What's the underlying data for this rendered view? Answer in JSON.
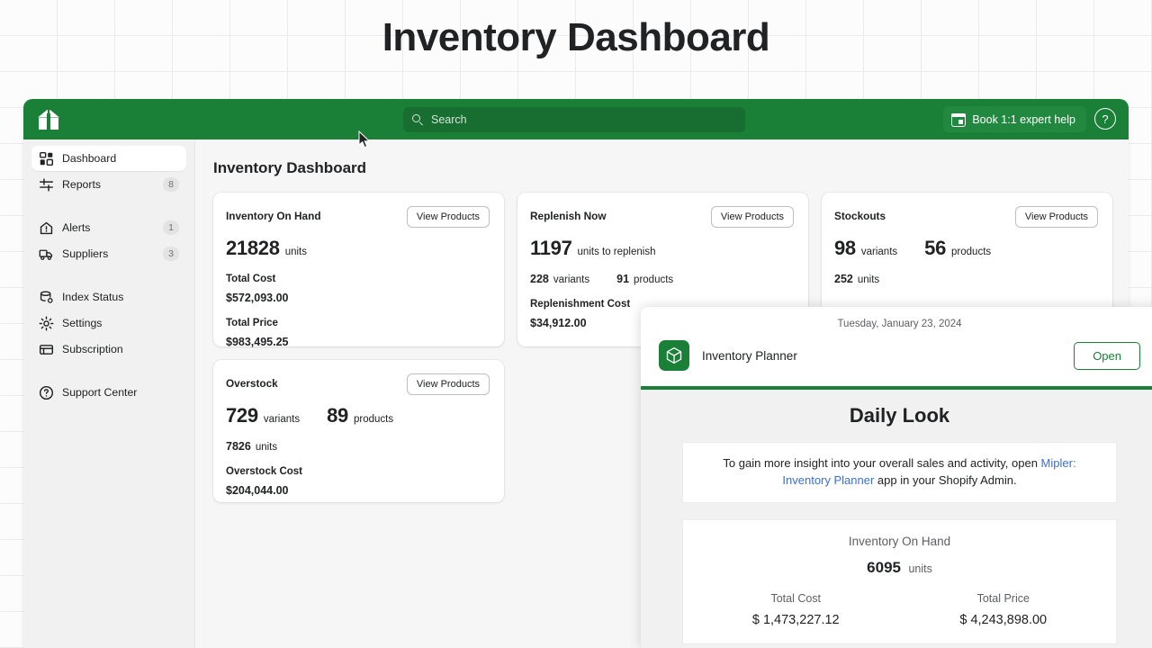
{
  "banner": {
    "title": "Inventory Dashboard"
  },
  "colors": {
    "brand_green": "#1a8038",
    "search_green": "#186e31",
    "link_blue": "#3b6fd4",
    "page_bg": "#f6f6f7",
    "sidebar_bg": "#f1f1f1"
  },
  "topbar": {
    "logo_icon": "open-box-logo-icon",
    "search_placeholder": "Search",
    "search_value": "",
    "search_icon": "search-icon",
    "book_help_label": "Book 1:1 expert help",
    "calendar_icon": "calendar-icon",
    "help_icon": "?"
  },
  "sidebar": {
    "items": [
      {
        "label": "Dashboard",
        "icon": "grid-icon",
        "badge": "",
        "active": true
      },
      {
        "label": "Reports",
        "icon": "filters-icon",
        "badge": "8",
        "active": false
      },
      {
        "label": "Alerts",
        "icon": "alert-home-icon",
        "badge": "1",
        "active": false
      },
      {
        "label": "Suppliers",
        "icon": "truck-icon",
        "badge": "3",
        "active": false
      },
      {
        "label": "Index Status",
        "icon": "database-gear-icon",
        "badge": "",
        "active": false
      },
      {
        "label": "Settings",
        "icon": "gear-icon",
        "badge": "",
        "active": false
      },
      {
        "label": "Subscription",
        "icon": "card-icon",
        "badge": "",
        "active": false
      },
      {
        "label": "Support Center",
        "icon": "question-circle-icon",
        "badge": "",
        "active": false
      }
    ]
  },
  "content": {
    "title": "Inventory Dashboard",
    "view_products_label": "View Products",
    "cards": {
      "inventory_on_hand": {
        "title": "Inventory On Hand",
        "big_number": "21828",
        "big_unit": "units",
        "total_cost_label": "Total Cost",
        "total_cost_value": "$572,093.00",
        "total_price_label": "Total Price",
        "total_price_value": "$983,495.25"
      },
      "replenish_now": {
        "title": "Replenish Now",
        "big_number": "1197",
        "big_unit": "units to replenish",
        "variants_number": "228",
        "variants_label": "variants",
        "products_number": "91",
        "products_label": "products",
        "cost_label": "Replenishment Cost",
        "cost_value": "$34,912.00"
      },
      "stockouts": {
        "title": "Stockouts",
        "variants_number": "98",
        "variants_label": "variants",
        "products_number": "56",
        "products_label": "products",
        "units_number": "252",
        "units_label": "units"
      },
      "overstock": {
        "title": "Overstock",
        "variants_number": "729",
        "variants_label": "variants",
        "products_number": "89",
        "products_label": "products",
        "units_number": "7826",
        "units_label": "units",
        "cost_label": "Overstock Cost",
        "cost_value": "$204,044.00"
      }
    }
  },
  "overlay": {
    "date": "Tuesday, January 23, 2024",
    "app_icon": "package-box-icon",
    "app_name": "Inventory Planner",
    "open_label": "Open",
    "heading": "Daily Look",
    "note_prefix": "To gain more insight into your overall sales and activity, open ",
    "note_link": "Mipler: Inventory Planner",
    "note_suffix": " app in your Shopify Admin.",
    "stats": {
      "title": "Inventory On Hand",
      "units_number": "6095",
      "units_label": "units",
      "total_cost_label": "Total Cost",
      "total_cost_value": "$ 1,473,227.12",
      "total_price_label": "Total Price",
      "total_price_value": "$ 4,243,898.00"
    }
  }
}
